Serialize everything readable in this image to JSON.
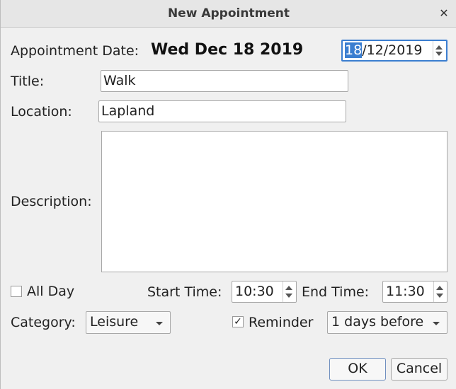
{
  "window": {
    "title": "New Appointment",
    "close_glyph": "✕"
  },
  "date_row": {
    "label": "Appointment Date:",
    "long_date": "Wed Dec 18 2019",
    "spinner_selected": "18",
    "spinner_rest": "/12/2019"
  },
  "title_field": {
    "label": "Title:",
    "value": "Walk"
  },
  "location_field": {
    "label": "Location:",
    "value": "Lapland"
  },
  "description_field": {
    "label": "Description:",
    "value": ""
  },
  "all_day": {
    "label": "All Day",
    "checked": false
  },
  "start_time": {
    "label": "Start Time:",
    "value": "10:30"
  },
  "end_time": {
    "label": "End Time:",
    "value": "11:30"
  },
  "category": {
    "label": "Category:",
    "selected": "Leisure"
  },
  "reminder": {
    "label": "Reminder",
    "checked": true,
    "check_glyph": "✓",
    "selected": "1 days before"
  },
  "buttons": {
    "ok": "OK",
    "cancel": "Cancel"
  },
  "colors": {
    "selection": "#3b7ed0",
    "dialog_bg": "#f0f0f0"
  }
}
